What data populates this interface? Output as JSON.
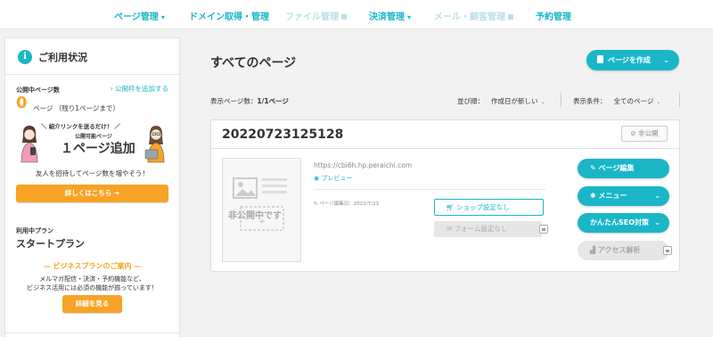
{
  "nav": {
    "items": [
      {
        "label": "ページ管理",
        "chevron": "⌄"
      },
      {
        "label": "ドメイン取得・管理"
      },
      {
        "label": "ファイル管理",
        "locked": true
      },
      {
        "label": "決済管理",
        "chevron": "⌄"
      },
      {
        "label": "メール・顧客管理",
        "locked": true
      },
      {
        "label": "予約管理"
      }
    ]
  },
  "sidebar": {
    "title": "ご利用状況",
    "title_icon": "info-icon",
    "published_label": "公開中ページ数",
    "add_link": "› 公開枠を追加する",
    "count": "0",
    "count_text": "ページ （残り1ページまで）",
    "promo_bubble": "＼ 紹介リンクを送るだけ！ ／",
    "promo_small": "公開可能ページ",
    "promo_big": "１ページ追加",
    "invite_text": "友人を招待してページ数を増やそう！",
    "details_button": "詳しくはこちら ➔",
    "plan_label": "利用中プラン",
    "plan_name": "スタートプラン",
    "biz_title": "— ビジネスプランのご案内 —",
    "biz_desc_1": "メルマガ配信・決済・予約機能など、",
    "biz_desc_2": "ビジネス活用には必須の機能が揃っています！",
    "biz_button": "詳細を見る"
  },
  "main": {
    "title": "すべてのページ",
    "create_button": "ページを作成",
    "display_count_label": "表示ページ数：",
    "display_count_value": "1/1ページ",
    "sort_label": "並び順：",
    "sort_value": "作成日が新しい",
    "filter_label": "表示条件：",
    "filter_value": "全てのページ"
  },
  "card": {
    "title": "20220723125128",
    "status": "非公開",
    "thumb_text": "非公開中です",
    "url": "https://cbi6h.hp.peraichi.com",
    "preview": "プレビュー",
    "edited": "ページ編集日：2022/7/23",
    "shop_button": "ショップ設定なし",
    "form_button": "フォーム設定なし",
    "edit_button": "ページ編集",
    "menu_button": "メニュー",
    "seo_button": "かんたんSEO対策",
    "analytics_button": "アクセス解析"
  },
  "colors": {
    "accent": "#1ab6c8",
    "orange": "#f7a326"
  }
}
